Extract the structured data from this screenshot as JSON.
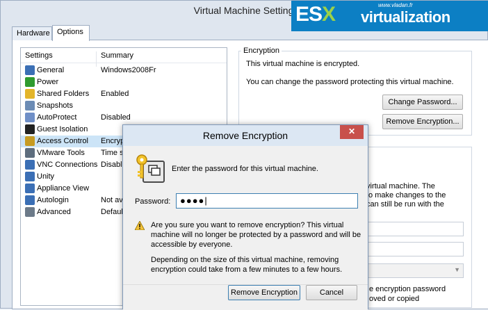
{
  "window": {
    "title": "Virtual Machine Settings"
  },
  "logo": {
    "es": "ES",
    "x": "X",
    "virt": "virtualization",
    "www": "www.vladan.fr"
  },
  "tabs": [
    {
      "label": "Hardware"
    },
    {
      "label": "Options"
    }
  ],
  "settings": {
    "col_settings": "Settings",
    "col_summary": "Summary",
    "items": [
      {
        "label": "General",
        "summary": "Windows2008Fr",
        "icon": "monitor-icon",
        "color": "#3b6fb5"
      },
      {
        "label": "Power",
        "summary": "",
        "icon": "play-icon",
        "color": "#2f9b2f"
      },
      {
        "label": "Shared Folders",
        "summary": "Enabled",
        "icon": "folder-icon",
        "color": "#e3b52a"
      },
      {
        "label": "Snapshots",
        "summary": "",
        "icon": "snapshot-icon",
        "color": "#6c8cb5"
      },
      {
        "label": "AutoProtect",
        "summary": "Disabled",
        "icon": "clock-icon",
        "color": "#6f8fc7"
      },
      {
        "label": "Guest Isolation",
        "summary": "",
        "icon": "lock-icon",
        "color": "#222222"
      },
      {
        "label": "Access Control",
        "summary": "Encryp",
        "icon": "key-icon",
        "color": "#c79b22"
      },
      {
        "label": "VMware Tools",
        "summary": "Time sy",
        "icon": "vm-icon",
        "color": "#5d6d7e"
      },
      {
        "label": "VNC Connections",
        "summary": "Disable",
        "icon": "vnc-icon",
        "color": "#3b6fb5"
      },
      {
        "label": "Unity",
        "summary": "",
        "icon": "unity-icon",
        "color": "#3b6fb5"
      },
      {
        "label": "Appliance View",
        "summary": "",
        "icon": "appliance-icon",
        "color": "#3b6fb5"
      },
      {
        "label": "Autologin",
        "summary": "Not av",
        "icon": "autologin-icon",
        "color": "#3b6fb5"
      },
      {
        "label": "Advanced",
        "summary": "Defaul",
        "icon": "advanced-icon",
        "color": "#6c7a89"
      }
    ]
  },
  "encryption": {
    "group_title": "Encryption",
    "line1": "This virtual machine is encrypted.",
    "line2": "You can change the password protecting this virtual machine.",
    "change_password_label": "Change Password...",
    "remove_encryption_label": "Remove Encryption..."
  },
  "background_text": {
    "l1": "virtual machine. The",
    "l2": "to make changes to the",
    "l3": "can still be run with the",
    "l4": "e encryption password",
    "l5": "oved or copied"
  },
  "dialog": {
    "title": "Remove Encryption",
    "close_glyph": "✕",
    "prompt": "Enter the password for this virtual machine.",
    "password_label": "Password:",
    "password_value": "●●●●|",
    "warning_text": "Are you sure you want to remove encryption? This virtual machine will no longer be protected by a password and will be accessible by everyone.",
    "info_text": "Depending on the size of this virtual machine, removing encryption could take from a few minutes to a few hours.",
    "remove_button_label": "Remove Encryption",
    "cancel_button_label": "Cancel"
  }
}
